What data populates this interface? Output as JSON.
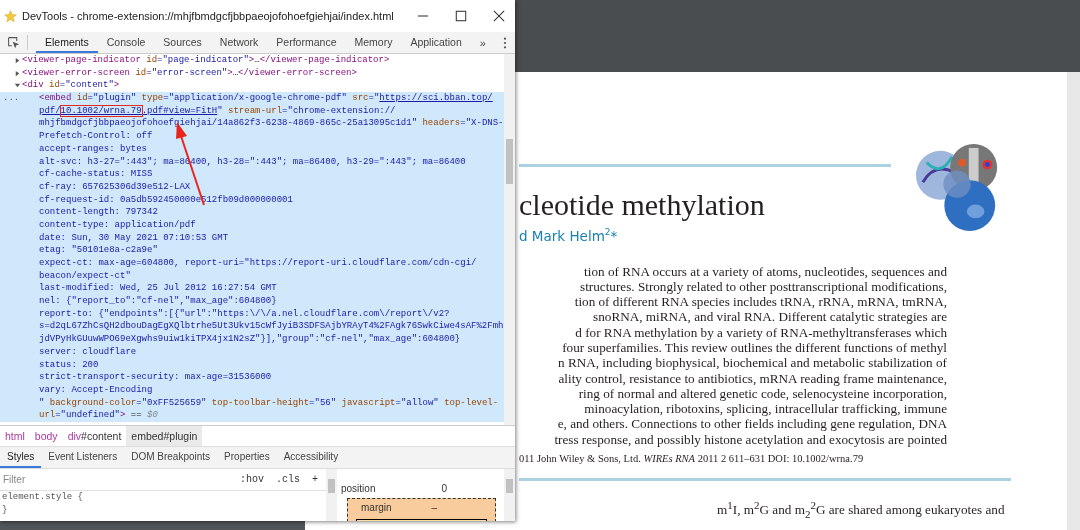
{
  "devtools": {
    "title": "DevTools - chrome-extension://mhjfbmdgcfjbbpaeojofohoefgiehjai/index.html",
    "tabs": [
      {
        "label": "Elements",
        "selected": true
      },
      {
        "label": "Console",
        "selected": false
      },
      {
        "label": "Sources",
        "selected": false
      },
      {
        "label": "Network",
        "selected": false
      },
      {
        "label": "Performance",
        "selected": false
      },
      {
        "label": "Memory",
        "selected": false
      },
      {
        "label": "Application",
        "selected": false
      }
    ],
    "more_tabs": "»",
    "tree": [
      {
        "expanded": false,
        "segments": [
          {
            "kind": "tag",
            "t": "<viewer-page-indicator"
          },
          {
            "kind": "attr",
            "t": " id"
          },
          {
            "kind": "value",
            "t": "=\"page-indicator\""
          },
          {
            "kind": "tag",
            "t": ">"
          },
          {
            "kind": "text",
            "t": "…"
          },
          {
            "kind": "tag",
            "t": "</viewer-page-indicator>"
          }
        ]
      },
      {
        "expanded": false,
        "segments": [
          {
            "kind": "tag",
            "t": "<viewer-error-screen"
          },
          {
            "kind": "attr",
            "t": " id"
          },
          {
            "kind": "value",
            "t": "=\"error-screen\""
          },
          {
            "kind": "tag",
            "t": ">"
          },
          {
            "kind": "text",
            "t": "…"
          },
          {
            "kind": "tag",
            "t": "</viewer-error-screen>"
          }
        ]
      },
      {
        "expanded": true,
        "segments": [
          {
            "kind": "tag",
            "t": "<div"
          },
          {
            "kind": "attr",
            "t": " id"
          },
          {
            "kind": "value",
            "t": "=\"content\""
          },
          {
            "kind": "tag",
            "t": ">"
          }
        ],
        "children": [
          {
            "selected": true,
            "gutter": "...",
            "lines": [
              [
                {
                  "kind": "tag",
                  "t": "<embed"
                },
                {
                  "kind": "attr",
                  "t": " id"
                },
                {
                  "kind": "value",
                  "t": "=\"plugin\""
                },
                {
                  "kind": "attr",
                  "t": " type"
                },
                {
                  "kind": "value",
                  "t": "=\"application/x-google-chrome-pdf\""
                },
                {
                  "kind": "attr",
                  "t": " src"
                },
                {
                  "kind": "value",
                  "t": "=\""
                },
                {
                  "kind": "link",
                  "parts": [
                    {
                      "t": "https://sci.bban.top/",
                      "boxed": false
                    }
                  ]
                }
              ],
              [
                {
                  "kind": "link",
                  "parts": [
                    {
                      "t": "pdf/",
                      "boxed": false
                    },
                    {
                      "t": "10.1002/wrna.79",
                      "boxed": true
                    },
                    {
                      "t": ".pdf#view=FitH",
                      "boxed": false
                    }
                  ]
                },
                {
                  "kind": "value",
                  "t": "\""
                },
                {
                  "kind": "attr",
                  "t": " stream-url"
                },
                {
                  "kind": "value",
                  "t": "=\"chrome-extension://"
                }
              ],
              [
                {
                  "kind": "value",
                  "t": "mhjfbmdgcfjbbpaeojofohoefgiehjai/14a862f3-6238-4869-865c-25a13095c1d1\""
                },
                {
                  "kind": "attr",
                  "t": " headers"
                },
                {
                  "kind": "value",
                  "t": "=\"X-DNS-"
                }
              ],
              [
                {
                  "kind": "value",
                  "t": "Prefetch-Control: off"
                }
              ],
              [
                {
                  "kind": "value",
                  "t": "accept-ranges: bytes"
                }
              ],
              [
                {
                  "kind": "value",
                  "t": "alt-svc: h3-27=\":443\"; ma=86400, h3-28=\":443\"; ma=86400, h3-29=\":443\"; ma=86400"
                }
              ],
              [
                {
                  "kind": "value",
                  "t": "cf-cache-status: MISS"
                }
              ],
              [
                {
                  "kind": "value",
                  "t": "cf-ray: 657625306d39e512-LAX"
                }
              ],
              [
                {
                  "kind": "value",
                  "t": "cf-request-id: 0a5db592450000e512fb09d000000001"
                }
              ],
              [
                {
                  "kind": "value",
                  "t": "content-length: 797342"
                }
              ],
              [
                {
                  "kind": "value",
                  "t": "content-type: application/pdf"
                }
              ],
              [
                {
                  "kind": "value",
                  "t": "date: Sun, 30 May 2021 07:10:53 GMT"
                }
              ],
              [
                {
                  "kind": "value",
                  "t": "etag: \"50101e8a-c2a9e\""
                }
              ],
              [
                {
                  "kind": "value",
                  "t": "expect-ct: max-age=604800, report-uri=\"https://report-uri.cloudflare.com/cdn-cgi/"
                }
              ],
              [
                {
                  "kind": "value",
                  "t": "beacon/expect-ct\""
                }
              ],
              [
                {
                  "kind": "value",
                  "t": "last-modified: Wed, 25 Jul 2012 16:27:54 GMT"
                }
              ],
              [
                {
                  "kind": "value",
                  "t": "nel: {\"report_to\":\"cf-nel\",\"max_age\":604800}"
                }
              ],
              [
                {
                  "kind": "value",
                  "t": "report-to: {\"endpoints\":[{\"url\":\"https:\\/\\/a.nel.cloudflare.com\\/report\\/v2?"
                }
              ],
              [
                {
                  "kind": "value",
                  "t": "s=d2qL67ZhCsQH2dbouDagEgXQlbtrhe5Ut3Ukv15cWfJyiB3SDFSAjbYRAyT4%2FAgk76SwkCiwe4sAF%2Fmh"
                }
              ],
              [
                {
                  "kind": "value",
                  "t": "jdVPyHkGUuwWPO69eXgwhs9uiw1kiTPX4jx1N2sZ\"}],\"group\":\"cf-nel\",\"max_age\":604800}"
                }
              ],
              [
                {
                  "kind": "value",
                  "t": "server: cloudflare"
                }
              ],
              [
                {
                  "kind": "value",
                  "t": "status: 200"
                }
              ],
              [
                {
                  "kind": "value",
                  "t": "strict-transport-security: max-age=31536000"
                }
              ],
              [
                {
                  "kind": "value",
                  "t": "vary: Accept-Encoding"
                }
              ],
              [
                {
                  "kind": "value",
                  "t": "\""
                },
                {
                  "kind": "attr",
                  "t": " background-color"
                },
                {
                  "kind": "value",
                  "t": "=\"0xFF525659\""
                },
                {
                  "kind": "attr",
                  "t": " top-toolbar-height"
                },
                {
                  "kind": "value",
                  "t": "=\"56\""
                },
                {
                  "kind": "attr",
                  "t": " javascript"
                },
                {
                  "kind": "value",
                  "t": "=\"allow\""
                },
                {
                  "kind": "attr",
                  "t": " top-level-"
                }
              ],
              [
                {
                  "kind": "attr",
                  "t": "url"
                },
                {
                  "kind": "value",
                  "t": "=\"undefined\""
                },
                {
                  "kind": "tag",
                  "t": ">"
                },
                {
                  "kind": "text",
                  "t": " == "
                },
                {
                  "kind": "ref",
                  "t": "$0"
                }
              ]
            ]
          }
        ]
      }
    ],
    "breadcrumbs": [
      {
        "tag": "html",
        "selected": false
      },
      {
        "tag": "body",
        "selected": false
      },
      {
        "tag": "div",
        "id": "#content",
        "selected": false
      },
      {
        "tag": "embed",
        "id": "#plugin",
        "selected": true
      }
    ],
    "subtabs": [
      {
        "label": "Styles",
        "selected": true
      },
      {
        "label": "Event Listeners",
        "selected": false
      },
      {
        "label": "DOM Breakpoints",
        "selected": false
      },
      {
        "label": "Properties",
        "selected": false
      },
      {
        "label": "Accessibility",
        "selected": false
      }
    ],
    "filter": {
      "placeholder": "Filter"
    },
    "style_buttons": [
      ":hov",
      ".cls",
      "+"
    ],
    "style_rule": [
      "element.style {",
      "}"
    ],
    "box_model": {
      "position_label": "position",
      "position_value": "0",
      "margin_label": "margin",
      "margin_value": "–"
    }
  },
  "pdf": {
    "title": "cleotide methylation",
    "authors": "d Mark Helm$^{2}$*",
    "abstract": [
      "tion of RNA occurs at a variety of atoms, nucleotides, sequences and",
      "structures. Strongly related to other posttranscriptional modifications,",
      "tion of different RNA species includes tRNA, rRNA, mRNA, tmRNA,",
      "snoRNA, miRNA, and viral RNA. Different catalytic strategies are",
      "d for RNA methylation by a variety of RNA-methyltransferases which",
      "four superfamilies. This review outlines the different functions of methyl",
      "n RNA, including biophysical, biochemical and metabolic stabilization of",
      "ality control, resistance to antibiotics, mRNA reading frame maintenance,",
      "ring of normal and altered genetic code, selenocysteine incorporation,",
      "minoacylation, ribotoxins, splicing, intracellular trafficking, immune",
      "e, and others. Connections to other fields including gene regulation, DNA",
      "tress response, and possibly histone acetylation and exocytosis are pointed"
    ],
    "citation": "011 John Wiley & Sons, Ltd. *WIREs RNA* 2011 2 611–631 DOI: 10.1002/wrna.79",
    "body_line": "m$^{1}$I, m$^{2}$G and m$_{2}$$^{2}$G are shared among eukaryotes and"
  }
}
